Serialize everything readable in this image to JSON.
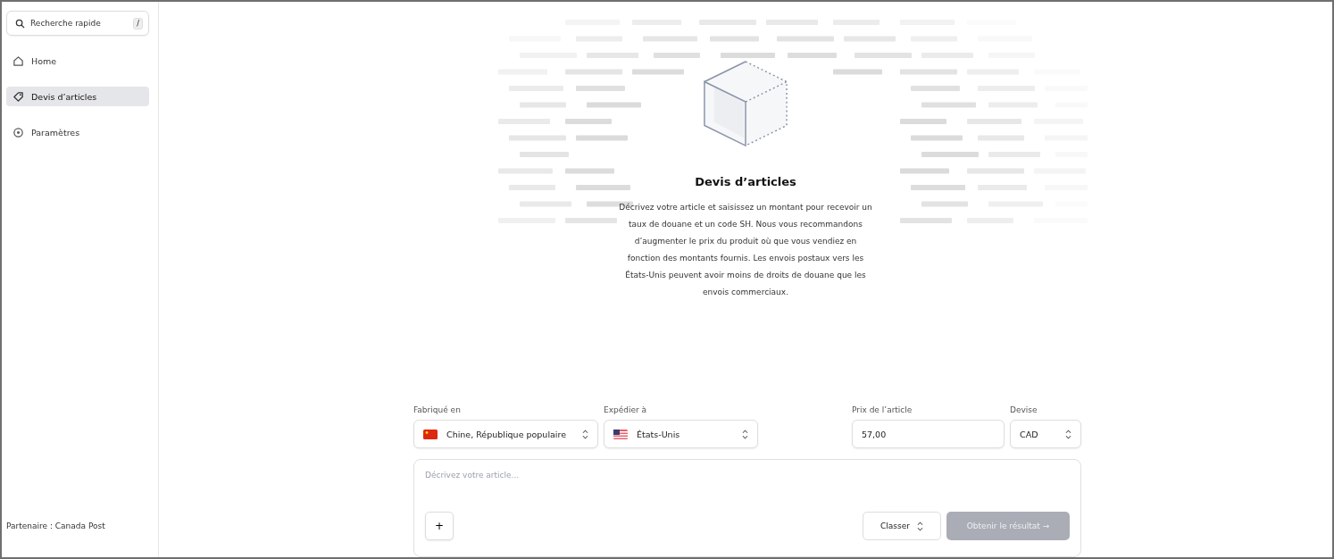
{
  "sidebar": {
    "search": {
      "placeholder": "Recherche rapide",
      "shortcut": "/"
    },
    "items": [
      {
        "label": "Home",
        "selected": false
      },
      {
        "label": "Devis d’articles",
        "selected": true
      },
      {
        "label": "Paramètres",
        "selected": false
      }
    ],
    "footer": "Partenaire : Canada Post"
  },
  "hero": {
    "title": "Devis d’articles",
    "description": "Décrivez votre article et saisissez un montant pour recevoir un taux de douane et un code SH. Nous vous recommandons d’augmenter le prix du produit où que vous vendiez en fonction des montants fournis. Les envois postaux vers les États-Unis peuvent avoir moins de droits de douane que les envois commerciaux."
  },
  "form": {
    "fields": [
      {
        "kind": "select",
        "label": "Fabriqué en",
        "value": "Chine, République populaire"
      },
      {
        "kind": "select",
        "label": "Expédier à",
        "value": "États-Unis"
      },
      {
        "kind": "input",
        "label": "Prix de l’article",
        "value": "57,00"
      },
      {
        "kind": "select",
        "label": "Devise",
        "value": "CAD"
      }
    ]
  },
  "composer": {
    "placeholder": "Décrivez votre article...",
    "add_button": "+",
    "sort_button": "Classer",
    "submit_button": {
      "label": "Obtenir le résultat",
      "arrow": "→",
      "disabled": true
    }
  }
}
